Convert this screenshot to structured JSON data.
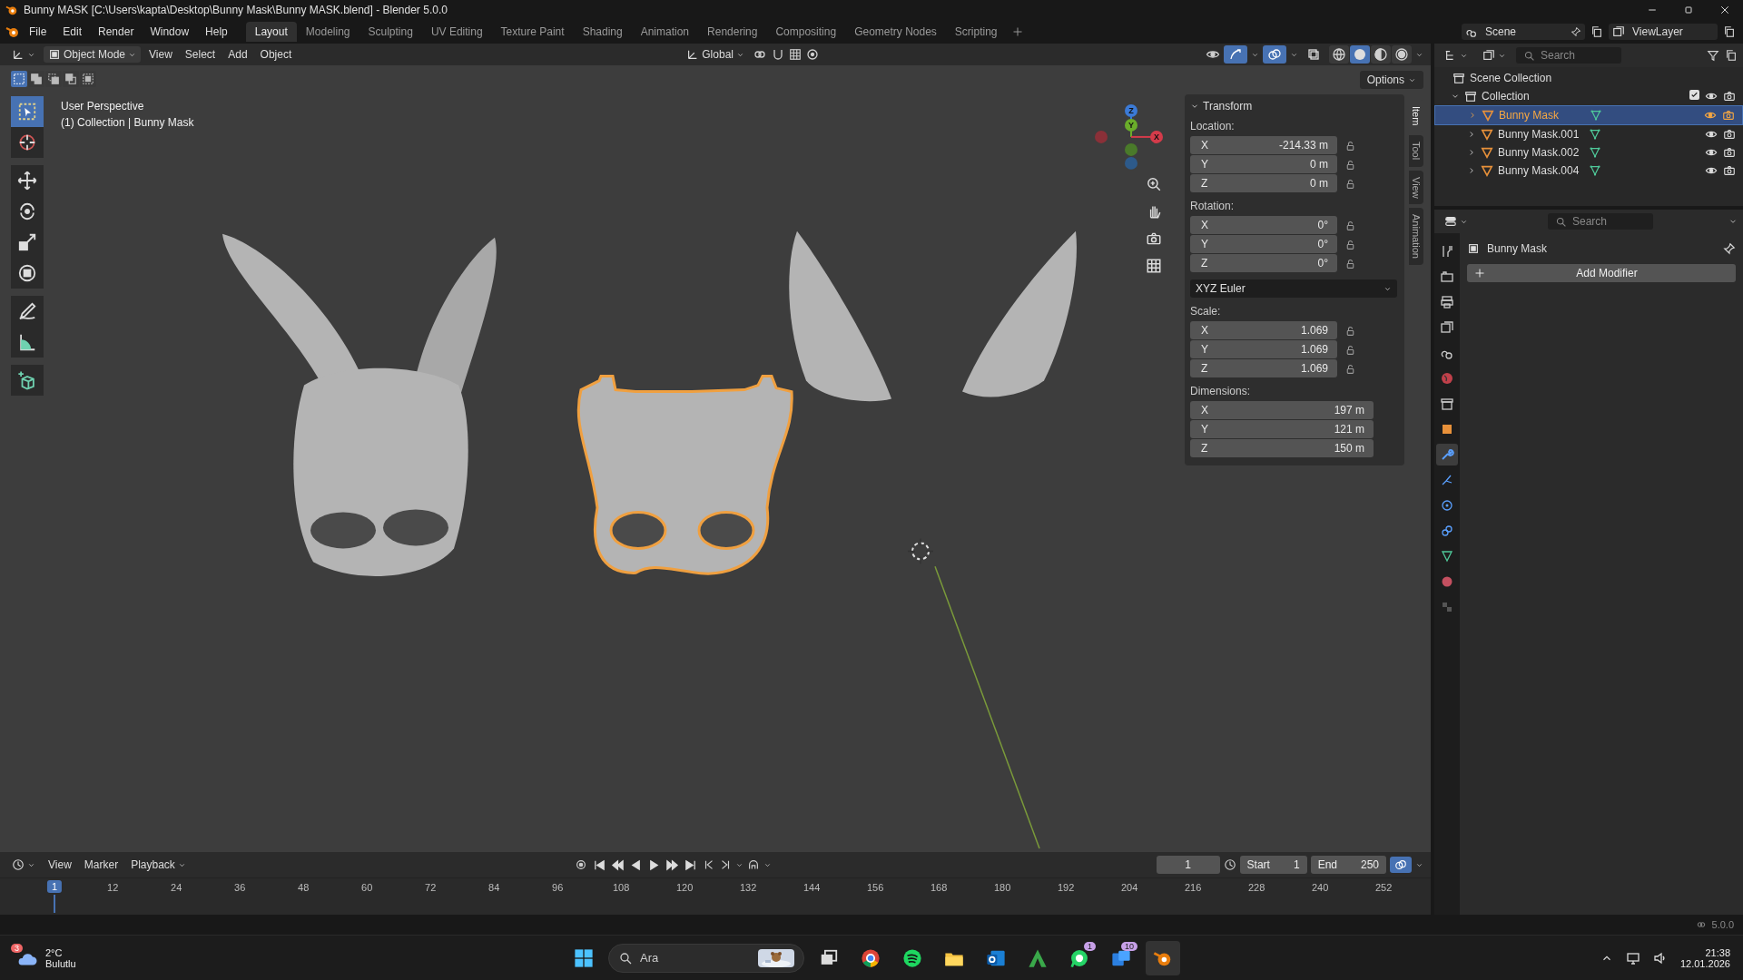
{
  "window": {
    "title": "Bunny MASK [C:\\Users\\kapta\\Desktop\\Bunny Mask\\Bunny MASK.blend] - Blender 5.0.0"
  },
  "menu": [
    "File",
    "Edit",
    "Render",
    "Window",
    "Help"
  ],
  "workspaces": [
    {
      "label": "Layout",
      "selected": true
    },
    {
      "label": "Modeling",
      "selected": false
    },
    {
      "label": "Sculpting",
      "selected": false
    },
    {
      "label": "UV Editing",
      "selected": false
    },
    {
      "label": "Texture Paint",
      "selected": false
    },
    {
      "label": "Shading",
      "selected": false
    },
    {
      "label": "Animation",
      "selected": false
    },
    {
      "label": "Rendering",
      "selected": false
    },
    {
      "label": "Compositing",
      "selected": false
    },
    {
      "label": "Geometry Nodes",
      "selected": false
    },
    {
      "label": "Scripting",
      "selected": false
    }
  ],
  "scene": "Scene",
  "view_layer": "ViewLayer",
  "viewport": {
    "mode": "Object Mode",
    "menus": [
      "View",
      "Select",
      "Add",
      "Object"
    ],
    "orientation": "Global",
    "toggles": [
      {
        "kind": "gizmo",
        "on": true
      },
      {
        "kind": "overlay",
        "on": true
      },
      {
        "kind": "xray",
        "on": false
      }
    ],
    "shading": [
      {
        "kind": "wireframe",
        "selected": false
      },
      {
        "kind": "solid",
        "selected": true
      },
      {
        "kind": "material",
        "selected": false
      },
      {
        "kind": "rendered",
        "selected": false
      }
    ],
    "select_modes": [
      {
        "selected": true
      },
      {
        "selected": false
      },
      {
        "selected": false
      },
      {
        "selected": false
      },
      {
        "selected": false
      }
    ],
    "tools": [
      {
        "kind": "select",
        "selected": true
      },
      {
        "kind": "cursor",
        "selected": false
      },
      {
        "kind": "move",
        "selected": false
      },
      {
        "kind": "rotate",
        "selected": false
      },
      {
        "kind": "scale",
        "selected": false
      },
      {
        "kind": "transform",
        "selected": false
      },
      {
        "kind": "annotate",
        "selected": false
      },
      {
        "kind": "measure",
        "selected": false
      },
      {
        "kind": "add_cube",
        "selected": false
      }
    ],
    "options": "Options",
    "info": [
      "User Perspective",
      "(1) Collection | Bunny Mask"
    ],
    "objects": [
      {
        "kind": "mask_with_ears",
        "selected": false
      },
      {
        "kind": "mask",
        "selected": true
      },
      {
        "kind": "ears",
        "selected": false
      }
    ],
    "gizmo": {
      "x": "X",
      "y": "Y",
      "z": "Z"
    }
  },
  "sidebar": {
    "tabs": [
      {
        "label": "Item",
        "selected": true
      },
      {
        "label": "Tool",
        "selected": false
      },
      {
        "label": "View",
        "selected": false
      },
      {
        "label": "Animation",
        "selected": false
      }
    ],
    "panel": {
      "title": "Transform",
      "expanded": true,
      "rows": [
        {
          "kind": "group",
          "label": "Location:",
          "locks": true,
          "fields": [
            {
              "axis": "X",
              "value": "-214.33 m"
            },
            {
              "axis": "Y",
              "value": "0 m"
            },
            {
              "axis": "Z",
              "value": "0 m"
            }
          ]
        },
        {
          "kind": "group",
          "label": "Rotation:",
          "locks": true,
          "fields": [
            {
              "axis": "X",
              "value": "0°"
            },
            {
              "axis": "Y",
              "value": "0°"
            },
            {
              "axis": "Z",
              "value": "0°"
            }
          ]
        },
        {
          "kind": "dropdown",
          "value": "XYZ Euler"
        },
        {
          "kind": "group",
          "label": "Scale:",
          "locks": true,
          "fields": [
            {
              "axis": "X",
              "value": "1.069"
            },
            {
              "axis": "Y",
              "value": "1.069"
            },
            {
              "axis": "Z",
              "value": "1.069"
            }
          ]
        },
        {
          "kind": "group",
          "label": "Dimensions:",
          "locks": false,
          "fields": [
            {
              "axis": "X",
              "value": "197 m"
            },
            {
              "axis": "Y",
              "value": "121 m"
            },
            {
              "axis": "Z",
              "value": "150 m"
            }
          ]
        }
      ]
    }
  },
  "outliner": {
    "search": {
      "placeholder": "Search"
    },
    "root": "Scene Collection",
    "collection": {
      "name": "Collection",
      "expanded": true,
      "checked": true,
      "children": [
        {
          "name": "Bunny Mask",
          "selected": true,
          "expanded": false
        },
        {
          "name": "Bunny Mask.001",
          "selected": false,
          "expanded": false
        },
        {
          "name": "Bunny Mask.002",
          "selected": false,
          "expanded": false
        },
        {
          "name": "Bunny Mask.004",
          "selected": false,
          "expanded": false
        }
      ]
    }
  },
  "properties": {
    "search": {
      "placeholder": "Search"
    },
    "object": "Bunny Mask",
    "add_modifier": "Add Modifier",
    "tabs": [
      {
        "kind": "tool",
        "selected": false
      },
      {
        "kind": "render",
        "selected": false
      },
      {
        "kind": "output",
        "selected": false
      },
      {
        "kind": "view_layer",
        "selected": false
      },
      {
        "kind": "scene",
        "selected": false
      },
      {
        "kind": "world",
        "selected": false
      },
      {
        "kind": "collection",
        "selected": false
      },
      {
        "kind": "object",
        "selected": false
      },
      {
        "kind": "modifier",
        "selected": true
      },
      {
        "kind": "particles",
        "selected": false
      },
      {
        "kind": "physics",
        "selected": false
      },
      {
        "kind": "constraints",
        "selected": false
      },
      {
        "kind": "data",
        "selected": false
      },
      {
        "kind": "material",
        "selected": false
      },
      {
        "kind": "texture",
        "selected": false
      }
    ]
  },
  "timeline": {
    "menus": [
      "View",
      "Marker"
    ],
    "playback": "Playback",
    "current_frame": "1",
    "start_label": "Start",
    "start": "1",
    "end_label": "End",
    "end": "250",
    "playhead": "1",
    "ticks": [
      "12",
      "24",
      "36",
      "48",
      "60",
      "72",
      "84",
      "96",
      "108",
      "120",
      "132",
      "144",
      "156",
      "168",
      "180",
      "192",
      "204",
      "216",
      "228",
      "240",
      "252"
    ]
  },
  "status_bar": {
    "version": "5.0.0"
  },
  "taskbar": {
    "weather": {
      "badge": "3",
      "temperature": "2°C",
      "condition": "Bulutlu"
    },
    "search": {
      "placeholder": "Ara"
    },
    "apps": [
      {
        "kind": "task_view",
        "active": false
      },
      {
        "kind": "browser",
        "active": false
      },
      {
        "kind": "music",
        "active": false
      },
      {
        "kind": "folder",
        "active": false
      },
      {
        "kind": "mail",
        "active": false
      },
      {
        "kind": "triangle",
        "active": false
      },
      {
        "kind": "chat",
        "active": false,
        "badge": "1"
      },
      {
        "kind": "store",
        "active": false,
        "badge": "10"
      },
      {
        "kind": "blender",
        "active": true
      }
    ],
    "time": "21:38",
    "date": "12.01.2026"
  }
}
